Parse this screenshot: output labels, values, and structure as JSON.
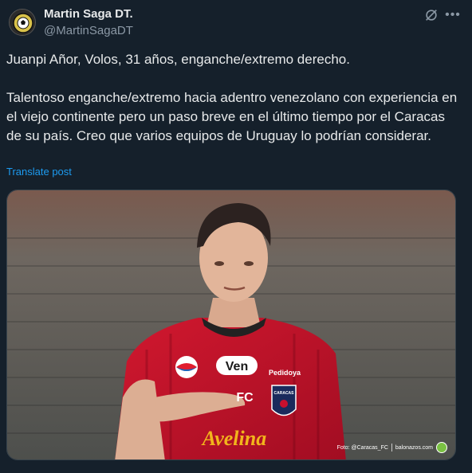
{
  "author": {
    "display_name": "Martin Saga DT.",
    "handle": "@MartinSagaDT",
    "avatar_icon": "soccer-ball-badge-icon"
  },
  "actions": {
    "grok_icon": "grok-icon",
    "more_icon": "more-options-icon"
  },
  "tweet": {
    "text": "Juanpi Añor, Volos, 31 años, enganche/extremo derecho.\n\nTalentoso enganche/extremo hacia adentro venezolano con experiencia en el viejo continente pero un paso breve en el último tiempo por el Caracas de su país. Creo que varios equipos de Uruguay lo podrían considerar.",
    "translate_label": "Translate post"
  },
  "media": {
    "jersey_sponsor_top": "Ven",
    "jersey_sponsor_right": "Pedidoya",
    "jersey_club_badge": "CARACAS",
    "jersey_chest_text": "FC",
    "jersey_main_sponsor": "Avelina",
    "photo_credit": "Foto: @Caracas_FC",
    "watermark": "balonazos.com"
  },
  "colors": {
    "background": "#15202b",
    "link": "#1d9bf0",
    "muted": "#8b98a5",
    "jersey_red": "#c8102e",
    "sponsor_gold": "#f2b51c"
  }
}
